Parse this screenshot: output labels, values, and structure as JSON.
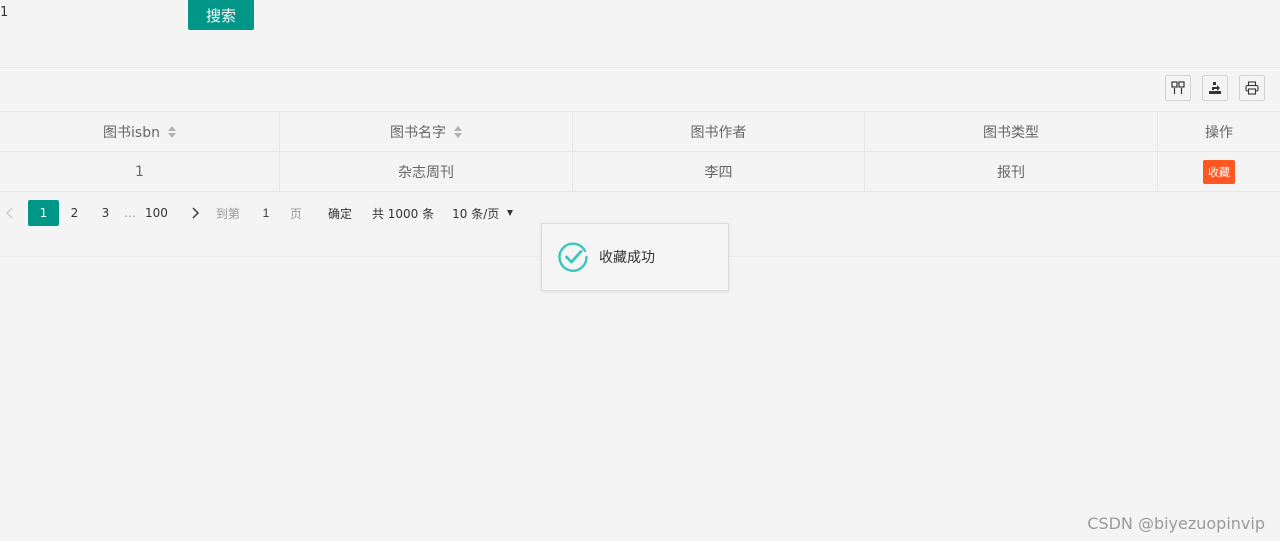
{
  "search": {
    "value": "1",
    "button_label": "搜索"
  },
  "toolbar": {
    "icons": [
      "columns-icon",
      "export-icon",
      "print-icon"
    ]
  },
  "table": {
    "columns": [
      {
        "label": "图书isbn",
        "sortable": true
      },
      {
        "label": "图书名字",
        "sortable": true
      },
      {
        "label": "图书作者",
        "sortable": false
      },
      {
        "label": "图书类型",
        "sortable": false
      },
      {
        "label": "操作",
        "sortable": false
      }
    ],
    "rows": [
      {
        "isbn": "1",
        "name": "杂志周刊",
        "author": "李四",
        "type": "报刊",
        "action_label": "收藏"
      }
    ]
  },
  "pagination": {
    "pages": [
      "1",
      "2",
      "3"
    ],
    "ellipsis": "…",
    "last_page": "100",
    "goto_label": "到第",
    "goto_value": "1",
    "page_unit": "页",
    "confirm_label": "确定",
    "total_label": "共 1000 条",
    "page_size_label": "10 条/页"
  },
  "toast": {
    "message": "收藏成功",
    "status": "success"
  },
  "watermark": "CSDN @biyezuopinvip",
  "colors": {
    "primary": "#009688",
    "danger": "#ff5722",
    "success_icon": "#3ec6b8"
  }
}
